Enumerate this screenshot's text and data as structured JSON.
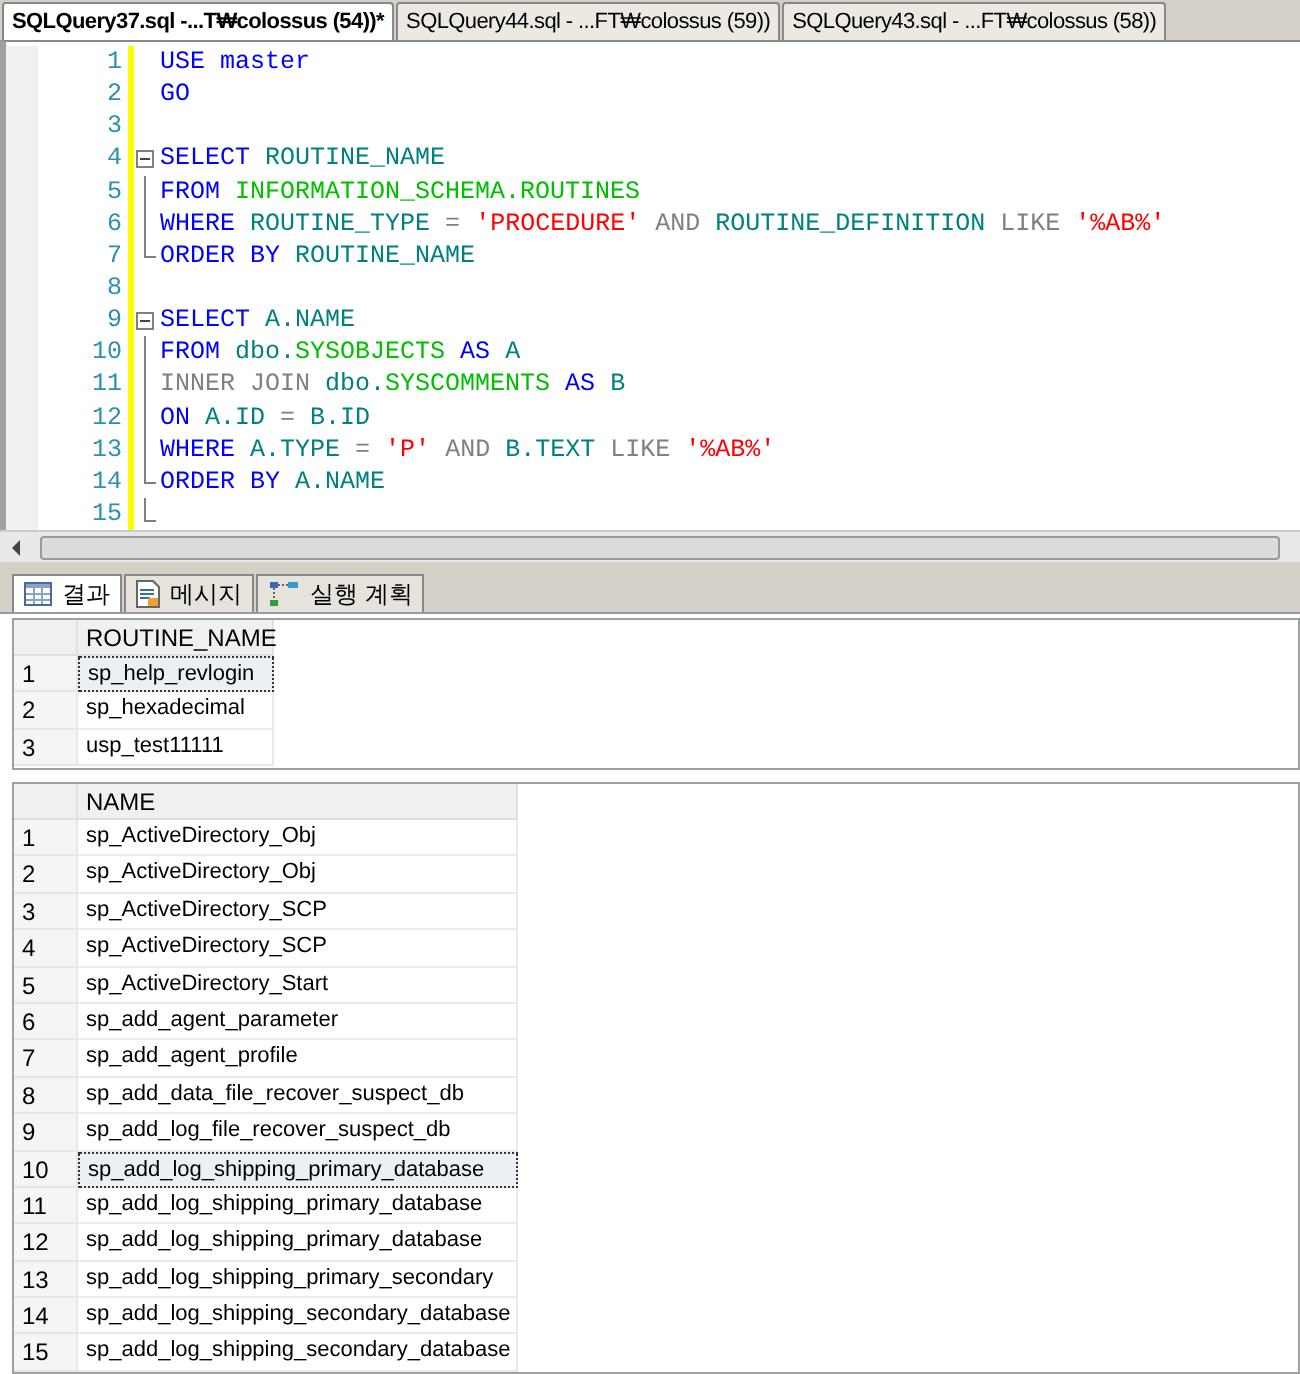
{
  "doc_tabs": [
    {
      "label": "SQLQuery37.sql -...T₩colossus (54))*",
      "selected": true
    },
    {
      "label": "SQLQuery44.sql - ...FT₩colossus (59))",
      "selected": false
    },
    {
      "label": "SQLQuery43.sql - ...FT₩colossus (58))",
      "selected": false
    }
  ],
  "editor": {
    "lines": [
      {
        "number": "1",
        "kind": "plain",
        "tokens": [
          {
            "text": "USE ",
            "kind": "keyword"
          },
          {
            "text": "master",
            "kind": "keyword"
          }
        ]
      },
      {
        "number": "2",
        "kind": "plain",
        "tokens": [
          {
            "text": "GO",
            "kind": "keyword"
          }
        ]
      },
      {
        "number": "3",
        "kind": "plain"
      },
      {
        "number": "4",
        "kind": "fold-start",
        "tokens": [
          {
            "text": "SELECT ",
            "kind": "keyword"
          },
          {
            "text": "ROUTINE_NAME",
            "kind": "ident"
          }
        ]
      },
      {
        "number": "5",
        "kind": "fold-inside",
        "tokens": [
          {
            "text": "FROM ",
            "kind": "keyword"
          },
          {
            "text": "INFORMATION_SCHEMA.ROUTINES",
            "kind": "object"
          }
        ]
      },
      {
        "number": "6",
        "kind": "fold-inside",
        "tokens": [
          {
            "text": "WHERE ",
            "kind": "keyword"
          },
          {
            "text": "ROUTINE_TYPE ",
            "kind": "ident"
          },
          {
            "text": "= ",
            "kind": "operator"
          },
          {
            "text": "'PROCEDURE' ",
            "kind": "string"
          },
          {
            "text": "AND ",
            "kind": "operator"
          },
          {
            "text": "ROUTINE_DEFINITION ",
            "kind": "ident"
          },
          {
            "text": "LIKE ",
            "kind": "operator"
          },
          {
            "text": "'%AB%'",
            "kind": "string"
          }
        ]
      },
      {
        "number": "7",
        "kind": "fold-end",
        "tokens": [
          {
            "text": "ORDER BY ",
            "kind": "keyword"
          },
          {
            "text": "ROUTINE_NAME",
            "kind": "ident"
          }
        ]
      },
      {
        "number": "8",
        "kind": "plain"
      },
      {
        "number": "9",
        "kind": "fold-start",
        "tokens": [
          {
            "text": "SELECT ",
            "kind": "keyword"
          },
          {
            "text": "A.NAME",
            "kind": "ident"
          }
        ]
      },
      {
        "number": "10",
        "kind": "fold-inside",
        "tokens": [
          {
            "text": "FROM ",
            "kind": "keyword"
          },
          {
            "text": "dbo.",
            "kind": "ident"
          },
          {
            "text": "SYSOBJECTS ",
            "kind": "object"
          },
          {
            "text": "AS ",
            "kind": "keyword"
          },
          {
            "text": "A",
            "kind": "ident"
          }
        ]
      },
      {
        "number": "11",
        "kind": "fold-inside",
        "tokens": [
          {
            "text": "INNER JOIN ",
            "kind": "operator"
          },
          {
            "text": "dbo.",
            "kind": "ident"
          },
          {
            "text": "SYSCOMMENTS ",
            "kind": "object"
          },
          {
            "text": "AS ",
            "kind": "keyword"
          },
          {
            "text": "B",
            "kind": "ident"
          }
        ]
      },
      {
        "number": "12",
        "kind": "fold-inside",
        "tokens": [
          {
            "text": "ON ",
            "kind": "keyword"
          },
          {
            "text": "A.ID ",
            "kind": "ident"
          },
          {
            "text": "= ",
            "kind": "operator"
          },
          {
            "text": "B.ID",
            "kind": "ident"
          }
        ]
      },
      {
        "number": "13",
        "kind": "fold-inside",
        "tokens": [
          {
            "text": "WHERE ",
            "kind": "keyword"
          },
          {
            "text": "A.TYPE ",
            "kind": "ident"
          },
          {
            "text": "= ",
            "kind": "operator"
          },
          {
            "text": "'P' ",
            "kind": "string"
          },
          {
            "text": "AND ",
            "kind": "operator"
          },
          {
            "text": "B.TEXT ",
            "kind": "ident"
          },
          {
            "text": "LIKE ",
            "kind": "operator"
          },
          {
            "text": "'%AB%'",
            "kind": "string"
          }
        ]
      },
      {
        "number": "14",
        "kind": "fold-end",
        "tokens": [
          {
            "text": "ORDER BY ",
            "kind": "keyword"
          },
          {
            "text": "A.NAME",
            "kind": "ident"
          }
        ]
      },
      {
        "number": "15",
        "kind": "fold-last"
      }
    ]
  },
  "result_tabs": [
    {
      "label": "결과",
      "selected": true
    },
    {
      "label": "메시지",
      "selected": false
    },
    {
      "label": "실행 계획",
      "selected": false
    }
  ],
  "grids": [
    {
      "column": "ROUTINE_NAME",
      "rows": [
        {
          "number": "1",
          "value": "sp_help_revlogin",
          "selected": true
        },
        {
          "number": "2",
          "value": "sp_hexadecimal",
          "selected": false
        },
        {
          "number": "3",
          "value": "usp_test11111",
          "selected": false
        }
      ]
    },
    {
      "column": "NAME",
      "rows": [
        {
          "number": "1",
          "value": "sp_ActiveDirectory_Obj",
          "selected": false
        },
        {
          "number": "2",
          "value": "sp_ActiveDirectory_Obj",
          "selected": false
        },
        {
          "number": "3",
          "value": "sp_ActiveDirectory_SCP",
          "selected": false
        },
        {
          "number": "4",
          "value": "sp_ActiveDirectory_SCP",
          "selected": false
        },
        {
          "number": "5",
          "value": "sp_ActiveDirectory_Start",
          "selected": false
        },
        {
          "number": "6",
          "value": "sp_add_agent_parameter",
          "selected": false
        },
        {
          "number": "7",
          "value": "sp_add_agent_profile",
          "selected": false
        },
        {
          "number": "8",
          "value": "sp_add_data_file_recover_suspect_db",
          "selected": false
        },
        {
          "number": "9",
          "value": "sp_add_log_file_recover_suspect_db",
          "selected": false
        },
        {
          "number": "10",
          "value": "sp_add_log_shipping_primary_database",
          "selected": true
        },
        {
          "number": "11",
          "value": "sp_add_log_shipping_primary_database",
          "selected": false
        },
        {
          "number": "12",
          "value": "sp_add_log_shipping_primary_database",
          "selected": false
        },
        {
          "number": "13",
          "value": "sp_add_log_shipping_primary_secondary",
          "selected": false
        },
        {
          "number": "14",
          "value": "sp_add_log_shipping_secondary_database",
          "selected": false
        },
        {
          "number": "15",
          "value": "sp_add_log_shipping_secondary_database",
          "selected": false
        }
      ]
    }
  ]
}
